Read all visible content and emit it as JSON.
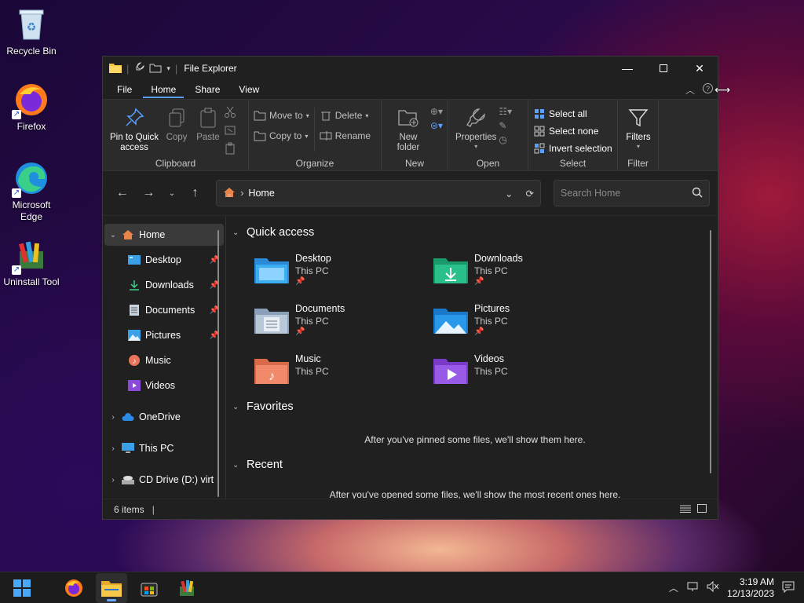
{
  "desktop": {
    "icons": [
      {
        "label": "Recycle Bin"
      },
      {
        "label": "Firefox"
      },
      {
        "label": "Microsoft Edge"
      },
      {
        "label": "Uninstall Tool"
      }
    ]
  },
  "window": {
    "title": "File Explorer",
    "tabs": [
      "File",
      "Home",
      "Share",
      "View"
    ],
    "active_tab": "Home"
  },
  "ribbon": {
    "clipboard": {
      "name": "Clipboard",
      "pin": "Pin to Quick access",
      "copy": "Copy",
      "paste": "Paste"
    },
    "organize": {
      "name": "Organize",
      "move_to": "Move to",
      "copy_to": "Copy to",
      "delete": "Delete",
      "rename": "Rename"
    },
    "new": {
      "name": "New",
      "new_folder": "New folder"
    },
    "open": {
      "name": "Open",
      "properties": "Properties"
    },
    "select": {
      "name": "Select",
      "select_all": "Select all",
      "select_none": "Select none",
      "invert": "Invert selection"
    },
    "filter": {
      "name": "Filter",
      "filters": "Filters"
    }
  },
  "address": {
    "path": "Home",
    "search_placeholder": "Search Home"
  },
  "nav": {
    "items": [
      {
        "label": "Home"
      },
      {
        "label": "Desktop"
      },
      {
        "label": "Downloads"
      },
      {
        "label": "Documents"
      },
      {
        "label": "Pictures"
      },
      {
        "label": "Music"
      },
      {
        "label": "Videos"
      },
      {
        "label": "OneDrive"
      },
      {
        "label": "This PC"
      },
      {
        "label": "CD Drive (D:) virt"
      }
    ]
  },
  "main": {
    "quick_access_title": "Quick access",
    "quick_items": [
      {
        "name": "Desktop",
        "location": "This PC",
        "pinned": "📌"
      },
      {
        "name": "Downloads",
        "location": "This PC",
        "pinned": "📌"
      },
      {
        "name": "Documents",
        "location": "This PC",
        "pinned": "📌"
      },
      {
        "name": "Pictures",
        "location": "This PC",
        "pinned": "📌"
      },
      {
        "name": "Music",
        "location": "This PC"
      },
      {
        "name": "Videos",
        "location": "This PC"
      }
    ],
    "favorites_title": "Favorites",
    "favorites_message": "After you've pinned some files, we'll show them here.",
    "recent_title": "Recent",
    "recent_message": "After you've opened some files, we'll show the most recent ones here."
  },
  "status": {
    "items": "6 items"
  },
  "taskbar": {
    "time": "3:19 AM",
    "date": "12/13/2023"
  },
  "colors": {
    "accent": "#5aa0ff",
    "folder": "#f5c542"
  }
}
